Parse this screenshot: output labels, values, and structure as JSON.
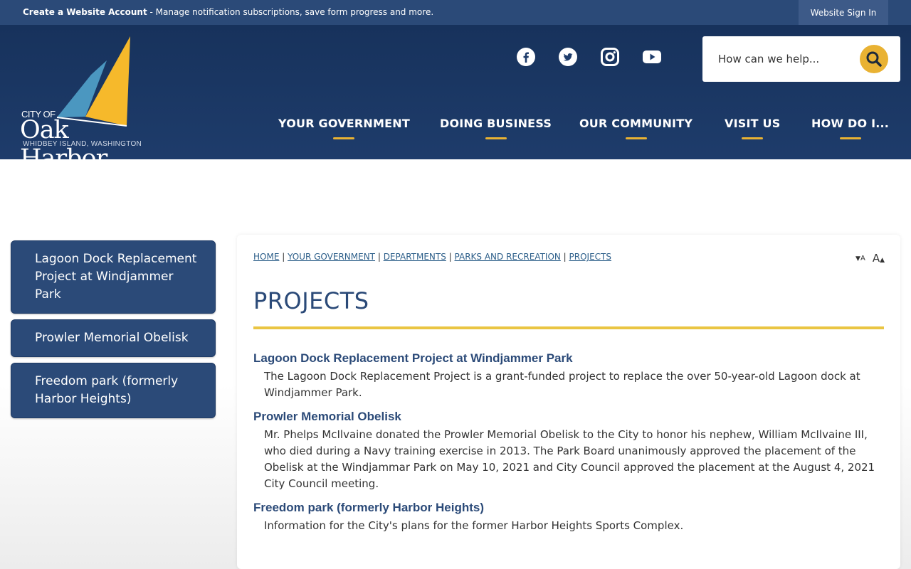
{
  "topbar": {
    "account_link": "Create a Website Account",
    "account_desc": " - Manage notification subscriptions, save form progress and more.",
    "signin": "Website Sign In"
  },
  "logo": {
    "city_of": "CITY OF",
    "name": "Oak Harbor",
    "tagline": "WHIDBEY ISLAND, WASHINGTON"
  },
  "social": [
    {
      "icon": "facebook-icon"
    },
    {
      "icon": "twitter-icon"
    },
    {
      "icon": "instagram-icon"
    },
    {
      "icon": "youtube-icon"
    }
  ],
  "search": {
    "placeholder": "How can we help..."
  },
  "nav": [
    {
      "label": "YOUR GOVERNMENT"
    },
    {
      "label": "DOING BUSINESS"
    },
    {
      "label": "OUR COMMUNITY"
    },
    {
      "label": "VISIT US"
    },
    {
      "label": "HOW DO I..."
    }
  ],
  "sidebar": {
    "items": [
      {
        "label": "Lagoon Dock Replacement Project at Windjammer Park"
      },
      {
        "label": "Prowler Memorial Obelisk"
      },
      {
        "label": "Freedom park (formerly Harbor Heights)"
      }
    ]
  },
  "breadcrumb": {
    "items": [
      "HOME",
      "YOUR GOVERNMENT",
      "DEPARTMENTS",
      "PARKS AND RECREATION",
      "PROJECTS"
    ],
    "separator": " | "
  },
  "font_controls": {
    "decrease": "A",
    "increase": "A"
  },
  "page_title": "PROJECTS",
  "projects": [
    {
      "title": "Lagoon Dock Replacement Project at Windjammer Park",
      "desc": "The Lagoon Dock Replacement Project is a grant-funded project to replace the over 50-year-old Lagoon dock at Windjammer Park."
    },
    {
      "title": "Prowler Memorial Obelisk",
      "desc": "Mr. Phelps McIlvaine donated the Prowler Memorial Obelisk to the City to honor his nephew, William McIlvaine III, who died during a Navy training exercise in 2013. The Park Board unanimously approved the placement of the Obelisk at the Windjammar Park on May 10, 2021 and City Council approved the placement at the August 4, 2021 City Council meeting."
    },
    {
      "title": "Freedom park (formerly Harbor Heights)",
      "desc": "Information for the City's plans for the former Harbor Heights Sports Complex."
    }
  ],
  "colors": {
    "primary": "#2b4a78",
    "header": "#17325c",
    "accent": "#e9b233",
    "link": "#2d5f8a"
  }
}
